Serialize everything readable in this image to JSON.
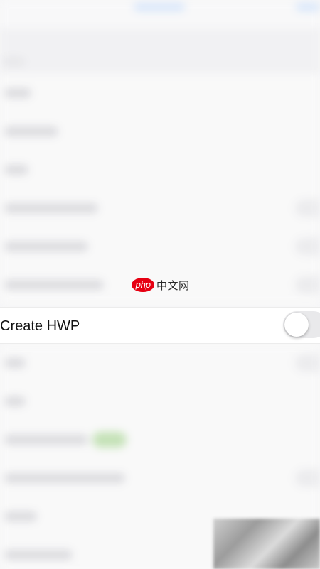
{
  "watermark": {
    "logo_text": "php",
    "site_text": "中文网"
  },
  "setting": {
    "label": "Create HWP",
    "toggle_on": false
  },
  "colors": {
    "watermark_red": "#e60012",
    "toggle_off_track": "#e9e9eb",
    "background": "#f6f6f7"
  },
  "icons": {
    "watermark_logo": "php-logo-icon"
  }
}
